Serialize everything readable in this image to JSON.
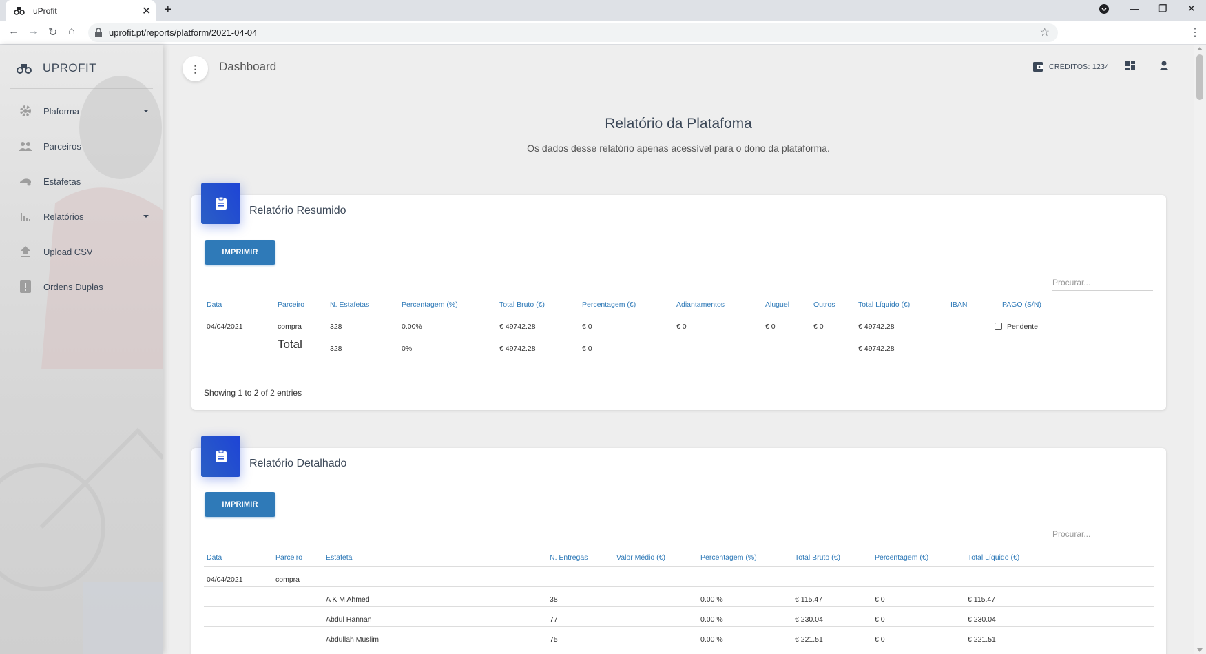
{
  "browser": {
    "tab_title": "uProfit",
    "url": "uprofit.pt/reports/platform/2021-04-04"
  },
  "sidebar": {
    "brand": "UPROFIT",
    "items": [
      {
        "label": "Plaforma",
        "icon": "gear-icon",
        "has_caret": true
      },
      {
        "label": "Parceiros",
        "icon": "people-icon",
        "has_caret": false
      },
      {
        "label": "Estafetas",
        "icon": "delivery-icon",
        "has_caret": false
      },
      {
        "label": "Relatórios",
        "icon": "bar-chart-icon",
        "has_caret": true
      },
      {
        "label": "Upload CSV",
        "icon": "upload-icon",
        "has_caret": false
      },
      {
        "label": "Ordens Duplas",
        "icon": "report-alert-icon",
        "has_caret": false
      }
    ]
  },
  "header": {
    "page_title": "Dashboard",
    "credits": "CRÉDITOS: 1234"
  },
  "report": {
    "title": "Relatório da Platafoma",
    "subtitle": "Os dados desse relatório apenas acessível para o dono da plataforma."
  },
  "summary": {
    "title": "Relatório Resumido",
    "print_label": "IMPRIMIR",
    "search_placeholder": "Procurar...",
    "columns": [
      "Data",
      "Parceiro",
      "N. Estafetas",
      "Percentagem (%)",
      "Total Bruto (€)",
      "Percentagem (€)",
      "Adiantamentos",
      "Aluguel",
      "Outros",
      "Total Líquido (€)",
      "IBAN",
      "PAGO (S/N)"
    ],
    "row": {
      "data": "04/04/2021",
      "parceiro": "compra",
      "n_estafetas": "328",
      "percentagem_pct": "0.00%",
      "total_bruto": "€ 49742.28",
      "percentagem_eur": "€ 0",
      "adiantamentos": "€ 0",
      "aluguel": "€ 0",
      "outros": "€ 0",
      "total_liquido": "€ 49742.28",
      "iban": "",
      "pago": "Pendente"
    },
    "total": {
      "label": "Total",
      "n_estafetas": "328",
      "percentagem_pct": "0%",
      "total_bruto": "€ 49742.28",
      "percentagem_eur": "€ 0",
      "total_liquido": "€ 49742.28"
    },
    "footer": "Showing 1 to 2 of 2 entries"
  },
  "detailed": {
    "title": "Relatório Detalhado",
    "print_label": "IMPRIMIR",
    "search_placeholder": "Procurar...",
    "columns": [
      "Data",
      "Parceiro",
      "Estafeta",
      "N. Entregas",
      "Valor Médio (€)",
      "Percentagem (%)",
      "Total Bruto (€)",
      "Percentagem (€)",
      "Total Líquido (€)"
    ],
    "group": {
      "data": "04/04/2021",
      "parceiro": "compra"
    },
    "rows": [
      {
        "estafeta": "A K M Ahmed",
        "entregas": "38",
        "valor_medio": "",
        "pct": "0.00 %",
        "bruto": "€ 115.47",
        "pct_eur": "€ 0",
        "liquido": "€ 115.47"
      },
      {
        "estafeta": "Abdul Hannan",
        "entregas": "77",
        "valor_medio": "",
        "pct": "0.00 %",
        "bruto": "€ 230.04",
        "pct_eur": "€ 0",
        "liquido": "€ 230.04"
      },
      {
        "estafeta": "Abdullah Muslim",
        "entregas": "75",
        "valor_medio": "",
        "pct": "0.00 %",
        "bruto": "€ 221.51",
        "pct_eur": "€ 0",
        "liquido": "€ 221.51"
      }
    ]
  }
}
